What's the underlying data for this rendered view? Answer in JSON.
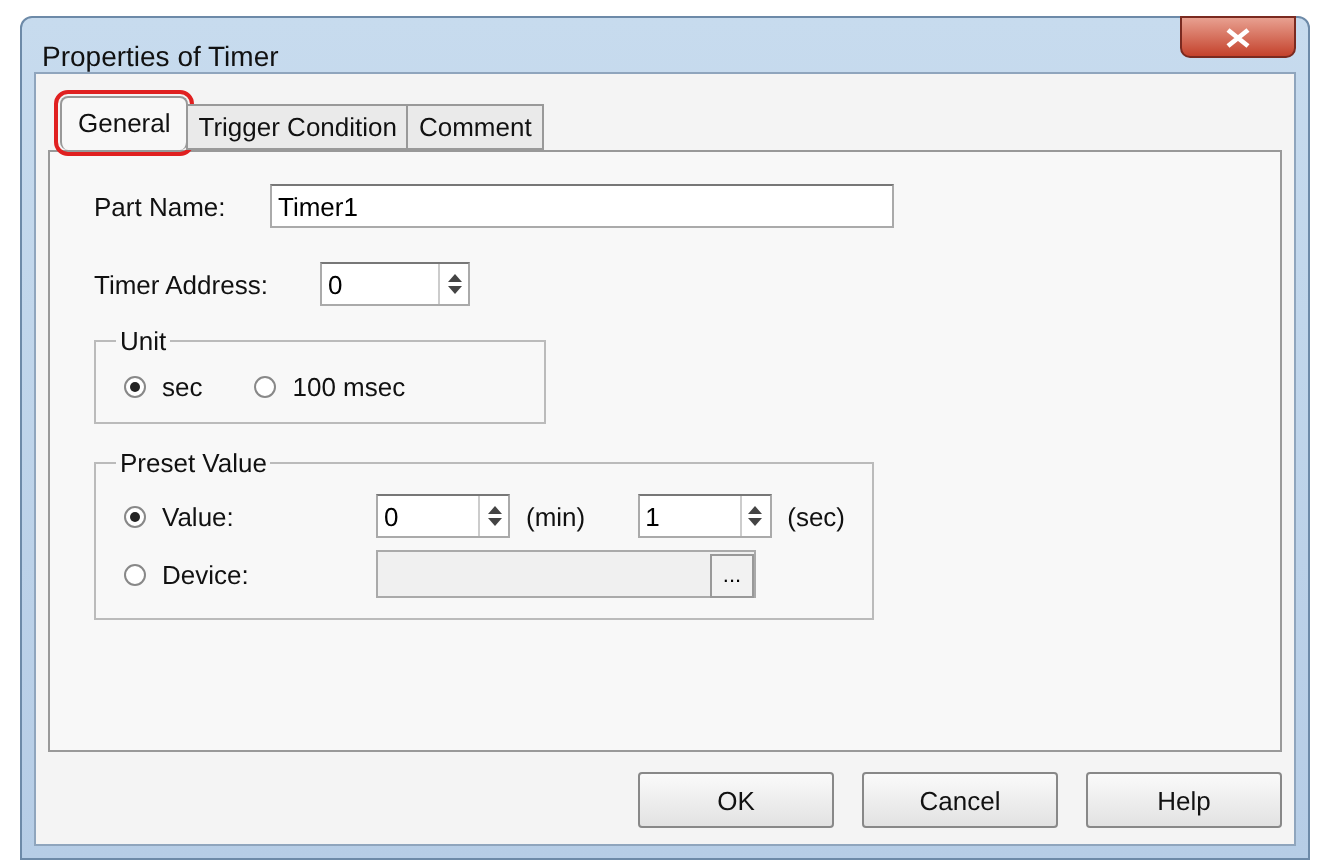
{
  "window": {
    "title": "Properties of Timer"
  },
  "tabs": [
    {
      "label": "General",
      "selected": true,
      "annotated": true
    },
    {
      "label": "Trigger Condition",
      "selected": false,
      "annotated": false
    },
    {
      "label": "Comment",
      "selected": false,
      "annotated": false
    }
  ],
  "part_name": {
    "label": "Part Name:",
    "value": "Timer1"
  },
  "timer_address": {
    "label": "Timer Address:",
    "value": "0"
  },
  "unit": {
    "title": "Unit",
    "options": [
      {
        "label": "sec",
        "selected": true
      },
      {
        "label": "100 msec",
        "selected": false
      }
    ]
  },
  "preset_value": {
    "title": "Preset Value",
    "value_row": {
      "label": "Value:",
      "selected": true,
      "minutes": "0",
      "min_unit": "(min)",
      "seconds": "1",
      "sec_unit": "(sec)"
    },
    "device_row": {
      "label": "Device:",
      "selected": false,
      "browse": "..."
    }
  },
  "buttons": [
    "OK",
    "Cancel",
    "Help"
  ]
}
